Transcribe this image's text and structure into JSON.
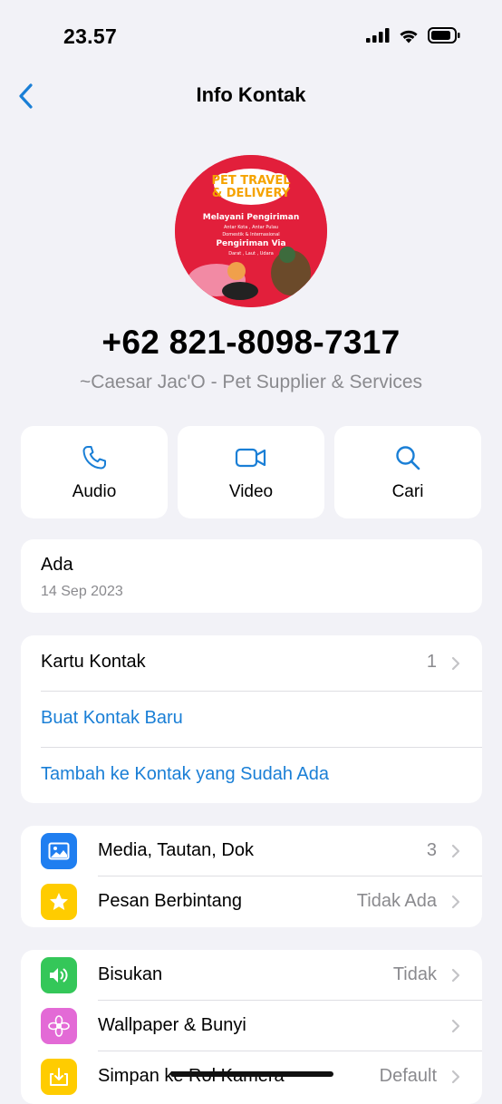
{
  "status_bar": {
    "time": "23.57"
  },
  "nav": {
    "title": "Info Kontak"
  },
  "profile": {
    "avatar_text": {
      "heading": "PET TRAVEL & DELIVERY",
      "line1": "Melayani Pengiriman",
      "line2": "Antar Kota , Antar Pulau",
      "line3": "Domestik & Internasional",
      "line4": "Pengiriman Via",
      "line5": "Darat , Laut , Udara"
    },
    "phone": "+62 821-8098-7317",
    "pushname": "~Caesar Jac'O - Pet Supplier & Services"
  },
  "actions": [
    {
      "label": "Audio",
      "icon": "phone-icon"
    },
    {
      "label": "Video",
      "icon": "video-camera-icon"
    },
    {
      "label": "Cari",
      "icon": "search-icon"
    }
  ],
  "about": {
    "status": "Ada",
    "date": "14 Sep 2023"
  },
  "contact_card": {
    "kartu_label": "Kartu Kontak",
    "kartu_count": "1",
    "new_contact": "Buat Kontak Baru",
    "add_existing": "Tambah ke Kontak yang Sudah Ada"
  },
  "media_section": {
    "media_label": "Media, Tautan, Dok",
    "media_count": "3",
    "starred_label": "Pesan Berbintang",
    "starred_value": "Tidak Ada"
  },
  "settings_section": {
    "mute_label": "Bisukan",
    "mute_value": "Tidak",
    "wallpaper_label": "Wallpaper & Bunyi",
    "save_label": "Simpan ke Rol Kamera",
    "save_value": "Default"
  },
  "colors": {
    "accent": "#1a7fd6",
    "media_icon_bg": "#1f7ef0",
    "starred_icon_bg": "#ffcc00",
    "mute_icon_bg": "#34c759",
    "wallpaper_icon_bg": "#e36ad6",
    "save_icon_bg": "#ffcc00"
  }
}
